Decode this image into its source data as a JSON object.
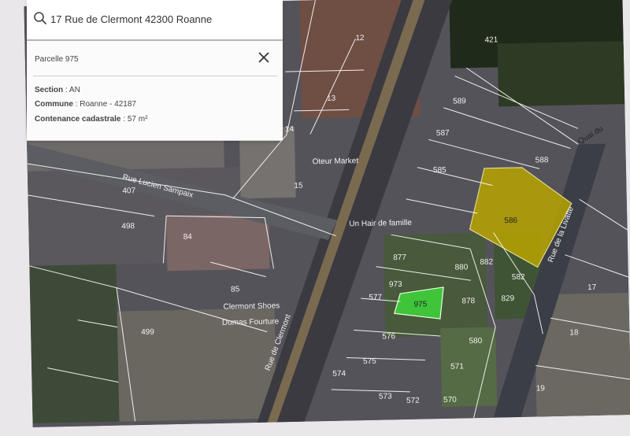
{
  "search": {
    "value": "17 Rue de Clermont 42300 Roanne",
    "icon": "search-icon"
  },
  "parcel": {
    "title": "Parcelle 975",
    "section_label": "Section",
    "section_value": "AN",
    "commune_label": "Commune",
    "commune_value": "Roanne - 42187",
    "contenance_label": "Contenance cadastrale",
    "contenance_value": "57 m²",
    "close_icon": "close-icon"
  },
  "map": {
    "parcel_numbers": [
      "12",
      "13",
      "14",
      "15",
      "589",
      "587",
      "585",
      "586",
      "588",
      "877",
      "880",
      "882",
      "582",
      "973",
      "975",
      "878",
      "829",
      "577",
      "576",
      "575",
      "574",
      "573",
      "572",
      "570",
      "571",
      "580",
      "17",
      "18",
      "19",
      "84",
      "85",
      "499",
      "498",
      "407",
      "421"
    ],
    "streets": [
      "Rue Lucien Sampaix",
      "Rue de Clermont",
      "Rue de la Livatte",
      "Quai du"
    ],
    "places": [
      "Oteur Market",
      "Un Hair de famille",
      "Clermont Shoes",
      "Dumas Fourture"
    ],
    "highlight_colors": {
      "selected": "#3fc43a",
      "adjacent": "#b8a400"
    }
  }
}
